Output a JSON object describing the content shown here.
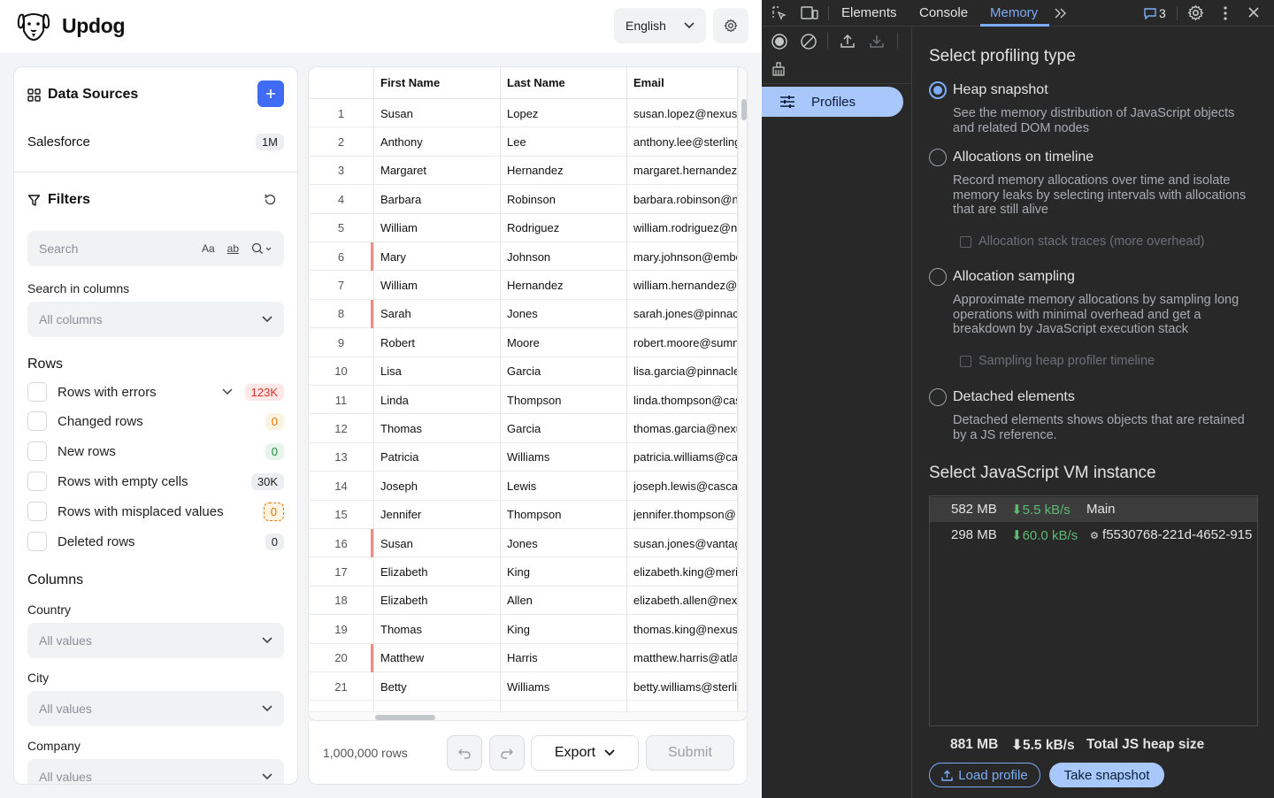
{
  "app": {
    "name": "Updog",
    "language": "English"
  },
  "sidebar": {
    "data_sources_title": "Data Sources",
    "sources": [
      {
        "name": "Salesforce",
        "count": "1M"
      }
    ],
    "filters_title": "Filters",
    "search_placeholder": "Search",
    "search_case_label": "Aa",
    "search_word_label": "ab",
    "search_in_columns_label": "Search in columns",
    "search_in_columns_value": "All columns",
    "rows_title": "Rows",
    "row_filters": [
      {
        "label": "Rows with errors",
        "count": "123K"
      },
      {
        "label": "Changed rows",
        "count": "0"
      },
      {
        "label": "New rows",
        "count": "0"
      },
      {
        "label": "Rows with empty cells",
        "count": "30K"
      },
      {
        "label": "Rows with misplaced values",
        "count": "0"
      },
      {
        "label": "Deleted rows",
        "count": "0"
      }
    ],
    "columns_title": "Columns",
    "column_filters": [
      {
        "label": "Country",
        "value": "All values"
      },
      {
        "label": "City",
        "value": "All values"
      },
      {
        "label": "Company",
        "value": "All values"
      }
    ]
  },
  "table": {
    "headers": [
      "First Name",
      "Last Name",
      "Email"
    ],
    "rows": [
      {
        "n": "1",
        "first": "Susan",
        "last": "Lopez",
        "email": "susan.lopez@nexust",
        "err": false
      },
      {
        "n": "2",
        "first": "Anthony",
        "last": "Lee",
        "email": "anthony.lee@sterling",
        "err": false
      },
      {
        "n": "3",
        "first": "Margaret",
        "last": "Hernandez",
        "email": "margaret.hernandez",
        "err": false
      },
      {
        "n": "4",
        "first": "Barbara",
        "last": "Robinson",
        "email": "barbara.robinson@n",
        "err": false
      },
      {
        "n": "5",
        "first": "William",
        "last": "Rodriguez",
        "email": "william.rodriguez@n",
        "err": false
      },
      {
        "n": "6",
        "first": "Mary",
        "last": "Johnson",
        "email": "mary.johnson@embe",
        "err": true
      },
      {
        "n": "7",
        "first": "William",
        "last": "Hernandez",
        "email": "william.hernandez@",
        "err": false
      },
      {
        "n": "8",
        "first": "Sarah",
        "last": "Jones",
        "email": "sarah.jones@pinnac",
        "err": true
      },
      {
        "n": "9",
        "first": "Robert",
        "last": "Moore",
        "email": "robert.moore@sumn",
        "err": false
      },
      {
        "n": "10",
        "first": "Lisa",
        "last": "Garcia",
        "email": "lisa.garcia@pinnacle",
        "err": false
      },
      {
        "n": "11",
        "first": "Linda",
        "last": "Thompson",
        "email": "linda.thompson@cas",
        "err": false
      },
      {
        "n": "12",
        "first": "Thomas",
        "last": "Garcia",
        "email": "thomas.garcia@nexu",
        "err": false
      },
      {
        "n": "13",
        "first": "Patricia",
        "last": "Williams",
        "email": "patricia.williams@ca",
        "err": false
      },
      {
        "n": "14",
        "first": "Joseph",
        "last": "Lewis",
        "email": "joseph.lewis@casca",
        "err": false
      },
      {
        "n": "15",
        "first": "Jennifer",
        "last": "Thompson",
        "email": "jennifer.thompson@",
        "err": false
      },
      {
        "n": "16",
        "first": "Susan",
        "last": "Jones",
        "email": "susan.jones@vantag",
        "err": true
      },
      {
        "n": "17",
        "first": "Elizabeth",
        "last": "King",
        "email": "elizabeth.king@meri",
        "err": false
      },
      {
        "n": "18",
        "first": "Elizabeth",
        "last": "Allen",
        "email": "elizabeth.allen@nex",
        "err": false
      },
      {
        "n": "19",
        "first": "Thomas",
        "last": "King",
        "email": "thomas.king@nexus",
        "err": false
      },
      {
        "n": "20",
        "first": "Matthew",
        "last": "Harris",
        "email": "matthew.harris@atla",
        "err": true
      },
      {
        "n": "21",
        "first": "Betty",
        "last": "Williams",
        "email": "betty.williams@sterli",
        "err": false
      }
    ],
    "footer": {
      "rows_count": "1,000,000 rows",
      "export_label": "Export",
      "submit_label": "Submit"
    }
  },
  "devtools": {
    "tabs": [
      "Elements",
      "Console",
      "Memory"
    ],
    "active_tab": "Memory",
    "issues_count": "3",
    "sidebar_item": "Profiles",
    "select_type_title": "Select profiling type",
    "options": [
      {
        "title": "Heap snapshot",
        "desc": "See the memory distribution of JavaScript objects and related DOM nodes",
        "checked": true
      },
      {
        "title": "Allocations on timeline",
        "desc": "Record memory allocations over time and isolate memory leaks by selecting intervals with allocations that are still alive",
        "sub": "Allocation stack traces (more overhead)"
      },
      {
        "title": "Allocation sampling",
        "desc": "Approximate memory allocations by sampling long operations with minimal overhead and get a breakdown by JavaScript execution stack",
        "sub": "Sampling heap profiler timeline"
      },
      {
        "title": "Detached elements",
        "desc": "Detached elements shows objects that are retained by a JS reference."
      }
    ],
    "vm_title": "Select JavaScript VM instance",
    "vm_instances": [
      {
        "size": "582 MB",
        "rate": "5.5 kB/s",
        "name": "Main"
      },
      {
        "size": "298 MB",
        "rate": "60.0 kB/s",
        "name": "f5530768-221d-4652-915"
      }
    ],
    "total": {
      "size": "881 MB",
      "rate": "5.5 kB/s",
      "label": "Total JS heap size"
    },
    "load_label": "Load profile",
    "snapshot_label": "Take snapshot"
  },
  "colors": {
    "accent": "#3f6bf5",
    "error_badge_bg": "#fde8e7",
    "error_badge_text": "#d93025",
    "changed_badge_bg": "#fdf3e1",
    "changed_badge_text": "#e37400",
    "new_badge_bg": "#e6f4ea",
    "new_badge_text": "#1e8e3e",
    "devtools_accent": "#7cacf8"
  }
}
